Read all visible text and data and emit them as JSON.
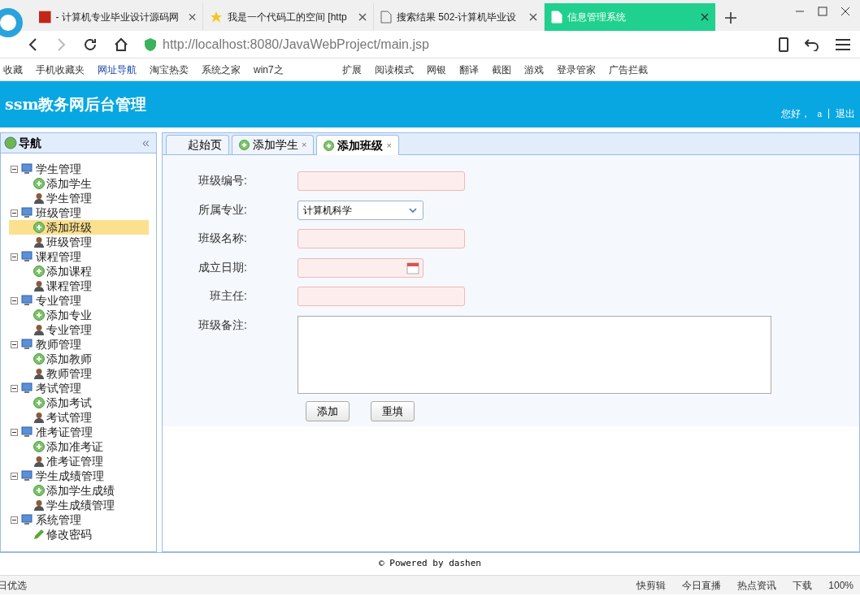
{
  "browser": {
    "tabs": [
      {
        "title": "- 计算机专业毕业设计源码网",
        "selected": false,
        "kind": "site"
      },
      {
        "title": "我是一个代码工的空间 [http",
        "selected": false,
        "kind": "star"
      },
      {
        "title": "搜索结果 502-计算机毕业设",
        "selected": false,
        "kind": "page"
      },
      {
        "title": "信息管理系统",
        "selected": true,
        "kind": "page"
      }
    ],
    "url": "http://localhost:8080/JavaWebProject/main.jsp",
    "bookmarks": [
      "收藏",
      "手机收藏夹",
      "网址导航",
      "淘宝热卖",
      "系统之家",
      "win7之"
    ],
    "extensions": [
      "扩展",
      "阅读模式",
      "网银",
      "翻译",
      "截图",
      "游戏",
      "登录管家",
      "广告拦截"
    ]
  },
  "app": {
    "title": "ssm教务网后台管理",
    "greeting": "您好，",
    "user": "a",
    "logout": "退出"
  },
  "nav": {
    "title": "导航",
    "collapse": "«",
    "groups": [
      {
        "label": "学生管理",
        "children": [
          {
            "label": "添加学生",
            "kind": "add",
            "selected": false
          },
          {
            "label": "学生管理",
            "kind": "manage",
            "selected": false
          }
        ]
      },
      {
        "label": "班级管理",
        "children": [
          {
            "label": "添加班级",
            "kind": "add",
            "selected": true
          },
          {
            "label": "班级管理",
            "kind": "manage",
            "selected": false
          }
        ]
      },
      {
        "label": "课程管理",
        "children": [
          {
            "label": "添加课程",
            "kind": "add",
            "selected": false
          },
          {
            "label": "课程管理",
            "kind": "manage",
            "selected": false
          }
        ]
      },
      {
        "label": "专业管理",
        "children": [
          {
            "label": "添加专业",
            "kind": "add",
            "selected": false
          },
          {
            "label": "专业管理",
            "kind": "manage",
            "selected": false
          }
        ]
      },
      {
        "label": "教师管理",
        "children": [
          {
            "label": "添加教师",
            "kind": "add",
            "selected": false
          },
          {
            "label": "教师管理",
            "kind": "manage",
            "selected": false
          }
        ]
      },
      {
        "label": "考试管理",
        "children": [
          {
            "label": "添加考试",
            "kind": "add",
            "selected": false
          },
          {
            "label": "考试管理",
            "kind": "manage",
            "selected": false
          }
        ]
      },
      {
        "label": "准考证管理",
        "children": [
          {
            "label": "添加准考证",
            "kind": "add",
            "selected": false
          },
          {
            "label": "准考证管理",
            "kind": "manage",
            "selected": false
          }
        ]
      },
      {
        "label": "学生成绩管理",
        "children": [
          {
            "label": "添加学生成绩",
            "kind": "add",
            "selected": false
          },
          {
            "label": "学生成绩管理",
            "kind": "manage",
            "selected": false
          }
        ]
      },
      {
        "label": "系统管理",
        "children": [
          {
            "label": "修改密码",
            "kind": "edit",
            "selected": false
          }
        ]
      }
    ]
  },
  "tabs": [
    {
      "label": "起始页",
      "selected": false,
      "closable": false,
      "icon": false
    },
    {
      "label": "添加学生",
      "selected": false,
      "closable": true,
      "icon": true
    },
    {
      "label": "添加班级",
      "selected": true,
      "closable": true,
      "icon": true
    }
  ],
  "tab_close": "×",
  "form": {
    "fields": [
      {
        "label": "班级编号:",
        "kind": "text"
      },
      {
        "label": "所属专业:",
        "kind": "select",
        "value": "计算机科学"
      },
      {
        "label": "班级名称:",
        "kind": "text"
      },
      {
        "label": "成立日期:",
        "kind": "date"
      },
      {
        "label": "班主任:",
        "kind": "text"
      },
      {
        "label": "班级备注:",
        "kind": "textarea"
      }
    ],
    "buttons": [
      "添加",
      "重填"
    ]
  },
  "footer": "© Powered by dashen",
  "status_bar": {
    "left": "日优选",
    "items": [
      "快剪辑",
      "今日直播",
      "热点资讯",
      "下载"
    ],
    "zoom": "100%"
  }
}
